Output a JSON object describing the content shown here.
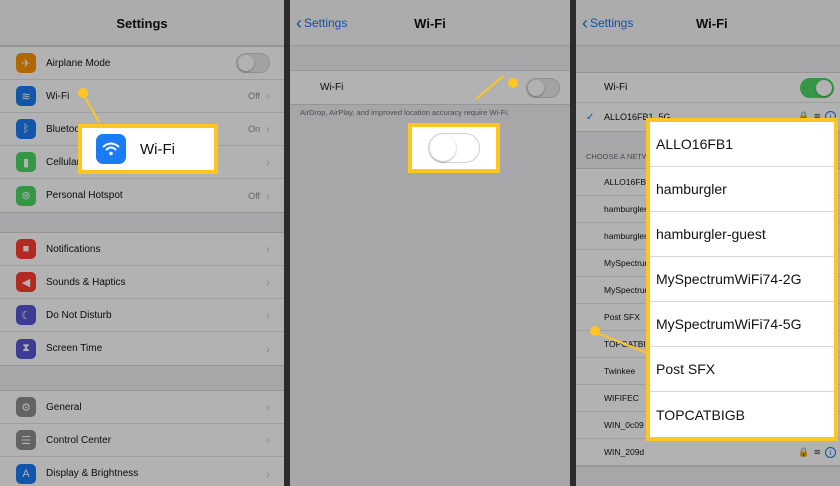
{
  "colors": {
    "highlight": "#ffc522",
    "ios_blue": "#1a73e8",
    "ios_green": "#4cd964"
  },
  "settings_panel": {
    "title": "Settings",
    "groups": [
      [
        {
          "label": "Airplane Mode",
          "icon": "airplane-icon",
          "color": "#ff9500",
          "control": "toggle"
        },
        {
          "label": "Wi-Fi",
          "icon": "wifi-icon",
          "color": "#1a7cf5",
          "value": "Off"
        },
        {
          "label": "Bluetooth",
          "icon": "bluetooth-icon",
          "color": "#1a7cf5",
          "value": "On"
        },
        {
          "label": "Cellular",
          "icon": "cellular-icon",
          "color": "#4cd964",
          "value": ""
        },
        {
          "label": "Personal Hotspot",
          "icon": "hotspot-icon",
          "color": "#4cd964",
          "value": "Off"
        }
      ],
      [
        {
          "label": "Notifications",
          "icon": "notifications-icon",
          "color": "#ff3b30",
          "value": ""
        },
        {
          "label": "Sounds & Haptics",
          "icon": "sounds-icon",
          "color": "#ff3b30",
          "value": ""
        },
        {
          "label": "Do Not Disturb",
          "icon": "moon-icon",
          "color": "#5856d6",
          "value": ""
        },
        {
          "label": "Screen Time",
          "icon": "hourglass-icon",
          "color": "#5856d6",
          "value": ""
        }
      ],
      [
        {
          "label": "General",
          "icon": "gear-icon",
          "color": "#8e8e93",
          "value": ""
        },
        {
          "label": "Control Center",
          "icon": "control-center-icon",
          "color": "#8e8e93",
          "value": ""
        },
        {
          "label": "Display & Brightness",
          "icon": "display-icon",
          "color": "#1a7cf5",
          "value": ""
        }
      ]
    ],
    "callout_label": "Wi-Fi"
  },
  "wifi_off_panel": {
    "back": "Settings",
    "title": "Wi-Fi",
    "row_label": "Wi-Fi",
    "footnote": "AirDrop, AirPlay, and improved location accuracy require Wi-Fi."
  },
  "wifi_on_panel": {
    "back": "Settings",
    "title": "Wi-Fi",
    "row_label": "Wi-Fi",
    "connected": "ALLO16FB1_5G",
    "section_header": "CHOOSE A NETWORK...",
    "networks": [
      "ALLO16FB1",
      "hamburgler",
      "hamburgler-guest",
      "MySpectrumWiFi74-2G",
      "MySpectrumWiFi74-5G",
      "Post SFX",
      "TOPCATBIGB",
      "Twinkee",
      "WIFIFEC",
      "WIN_0c09",
      "WIN_209d"
    ],
    "callout_networks": [
      "ALLO16FB1",
      "hamburgler",
      "hamburgler-guest",
      "MySpectrumWiFi74-2G",
      "MySpectrumWiFi74-5G",
      "Post SFX",
      "TOPCATBIGB"
    ]
  }
}
